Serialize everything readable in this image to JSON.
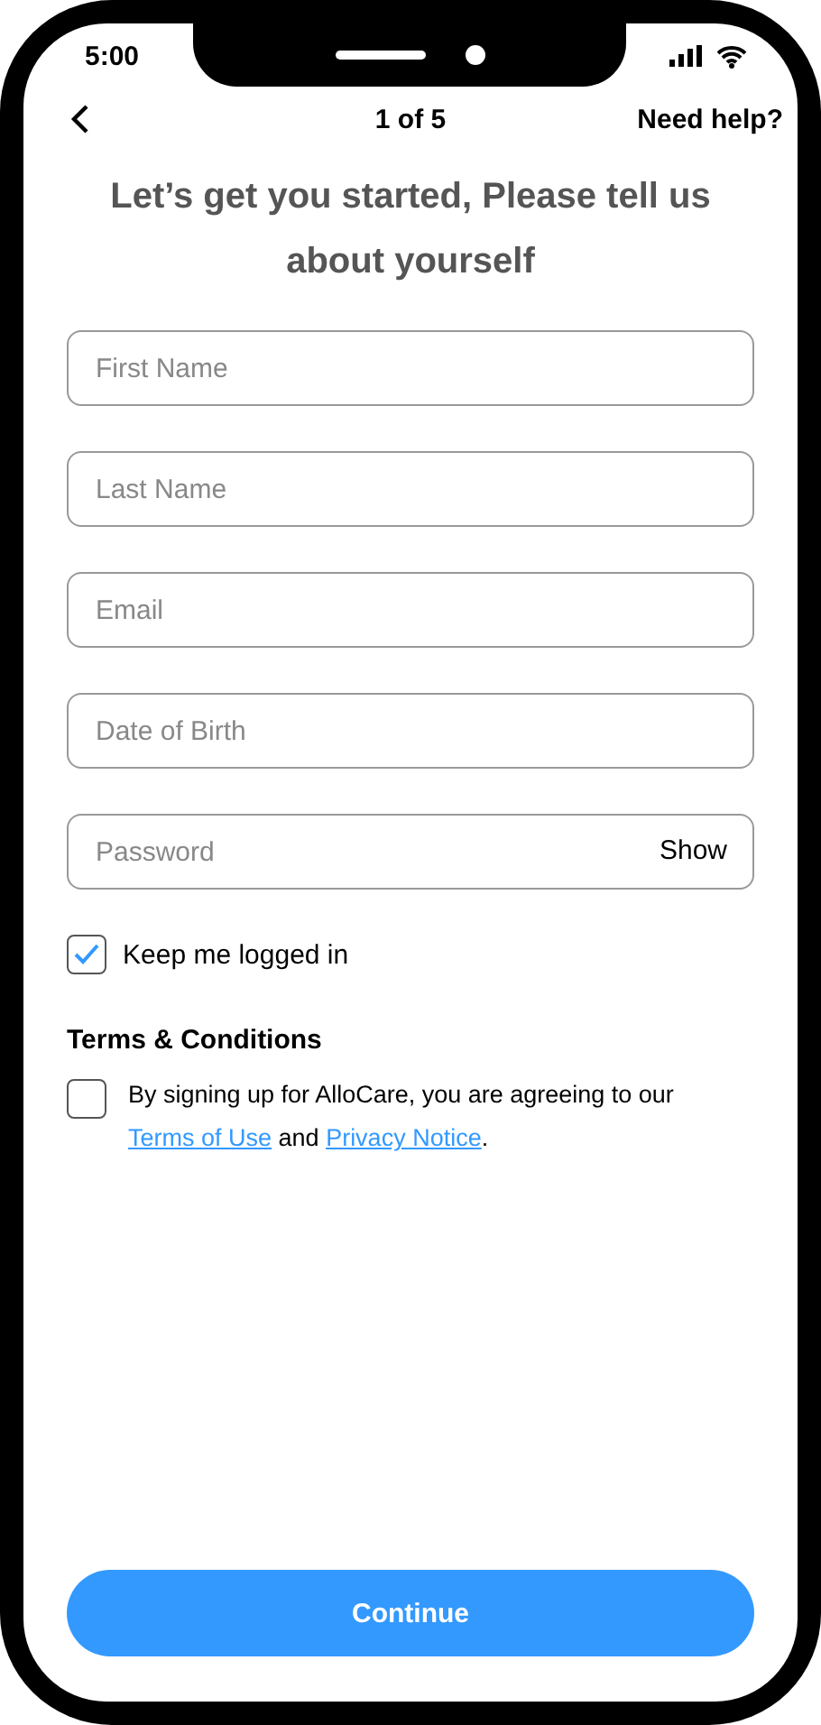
{
  "status_bar": {
    "time": "5:00"
  },
  "header": {
    "step": "1 of 5",
    "help": "Need help?"
  },
  "title": "Let’s get you started, Please tell us about yourself",
  "fields": [
    {
      "placeholder": "First Name"
    },
    {
      "placeholder": "Last Name"
    },
    {
      "placeholder": "Email"
    },
    {
      "placeholder": "Date of Birth"
    },
    {
      "placeholder": "Password",
      "action": "Show"
    }
  ],
  "keep_logged_in": {
    "label": "Keep me logged in",
    "checked": true
  },
  "terms": {
    "heading": "Terms & Conditions",
    "checked": false,
    "parts": [
      {
        "kind": "text",
        "text": "By signing up for AlloCare, you are agreeing to our "
      },
      {
        "kind": "link",
        "text": "Terms of Use"
      },
      {
        "kind": "text",
        "text": " and "
      },
      {
        "kind": "link",
        "text": "Privacy Notice"
      },
      {
        "kind": "text",
        "text": "."
      }
    ]
  },
  "continue_button": "Continue"
}
